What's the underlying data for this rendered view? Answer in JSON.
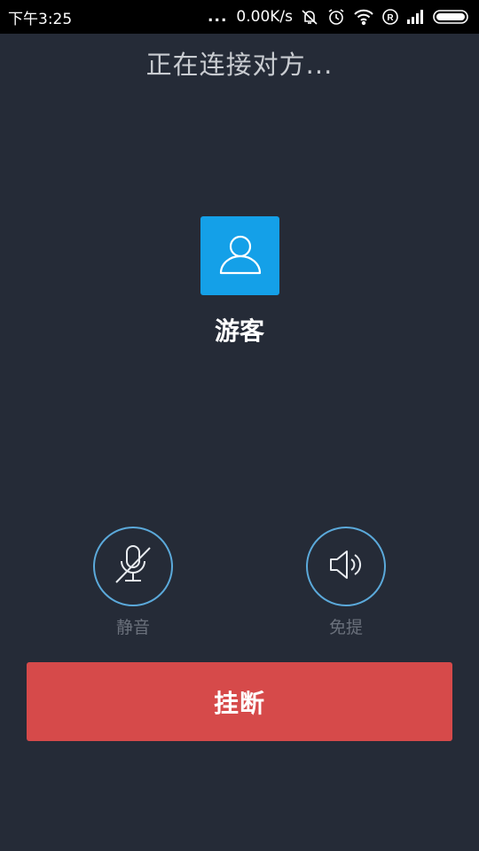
{
  "status_bar": {
    "time": "下午3:25",
    "dots": "...",
    "network_speed": "0.00K/s",
    "icons": [
      "bell-muted-icon",
      "alarm-icon",
      "wifi-icon",
      "registered-icon",
      "signal-icon",
      "battery-icon"
    ]
  },
  "call": {
    "status_text": "正在连接对方...",
    "caller_name": "游客",
    "avatar_icon": "person-icon"
  },
  "controls": {
    "mute_label": "静音",
    "mute_icon": "mic-off-icon",
    "speaker_label": "免提",
    "speaker_icon": "speaker-icon"
  },
  "hangup": {
    "label": "挂断"
  },
  "colors": {
    "background": "#252b37",
    "avatar": "#14a0e8",
    "hangup": "#d64a4a",
    "control_ring": "#5ba9da"
  }
}
